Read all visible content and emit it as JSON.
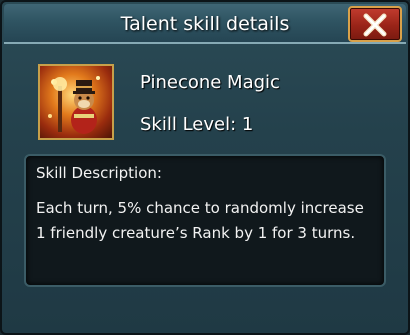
{
  "dialog": {
    "title": "Talent skill details",
    "close_icon": "close-x-icon"
  },
  "skill": {
    "icon": "pinecone-magic-skill-icon",
    "name": "Pinecone Magic",
    "level_text": "Skill Level: 1"
  },
  "description": {
    "heading": "Skill Description:",
    "line1": "Each turn, 5% chance to randomly increase",
    "line2": "1 friendly creature’s Rank by 1 for 3 turns."
  },
  "colors": {
    "panel_bg": "#24414c",
    "close_button": "#9a2418",
    "frame_gold": "#c7a04a"
  }
}
